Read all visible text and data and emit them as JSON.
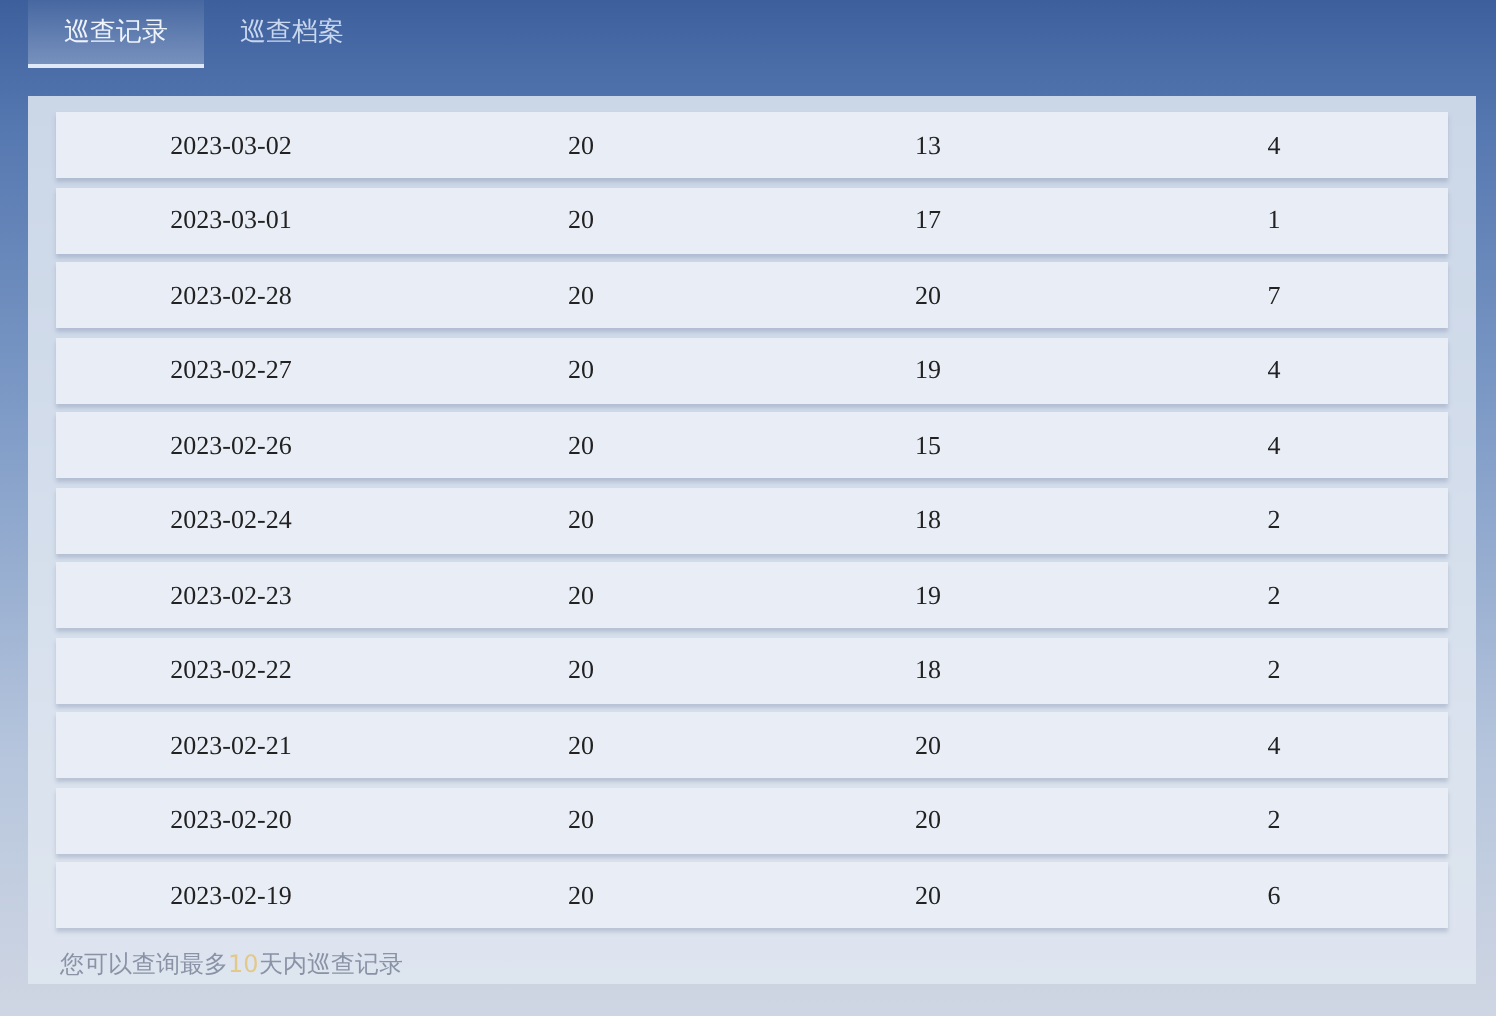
{
  "tabs": [
    {
      "label": "巡查记录",
      "selected": true
    },
    {
      "label": "巡查档案",
      "selected": false
    }
  ],
  "table": {
    "rows": [
      [
        "2023-03-02",
        "20",
        "13",
        "4"
      ],
      [
        "2023-03-01",
        "20",
        "17",
        "1"
      ],
      [
        "2023-02-28",
        "20",
        "20",
        "7"
      ],
      [
        "2023-02-27",
        "20",
        "19",
        "4"
      ],
      [
        "2023-02-26",
        "20",
        "15",
        "4"
      ],
      [
        "2023-02-24",
        "20",
        "18",
        "2"
      ],
      [
        "2023-02-23",
        "20",
        "19",
        "2"
      ],
      [
        "2023-02-22",
        "20",
        "18",
        "2"
      ],
      [
        "2023-02-21",
        "20",
        "20",
        "4"
      ],
      [
        "2023-02-20",
        "20",
        "20",
        "2"
      ],
      [
        "2023-02-19",
        "20",
        "20",
        "6"
      ]
    ]
  },
  "footer": {
    "before": "您可以查询最多",
    "number": "10",
    "after": "天内巡查记录"
  }
}
